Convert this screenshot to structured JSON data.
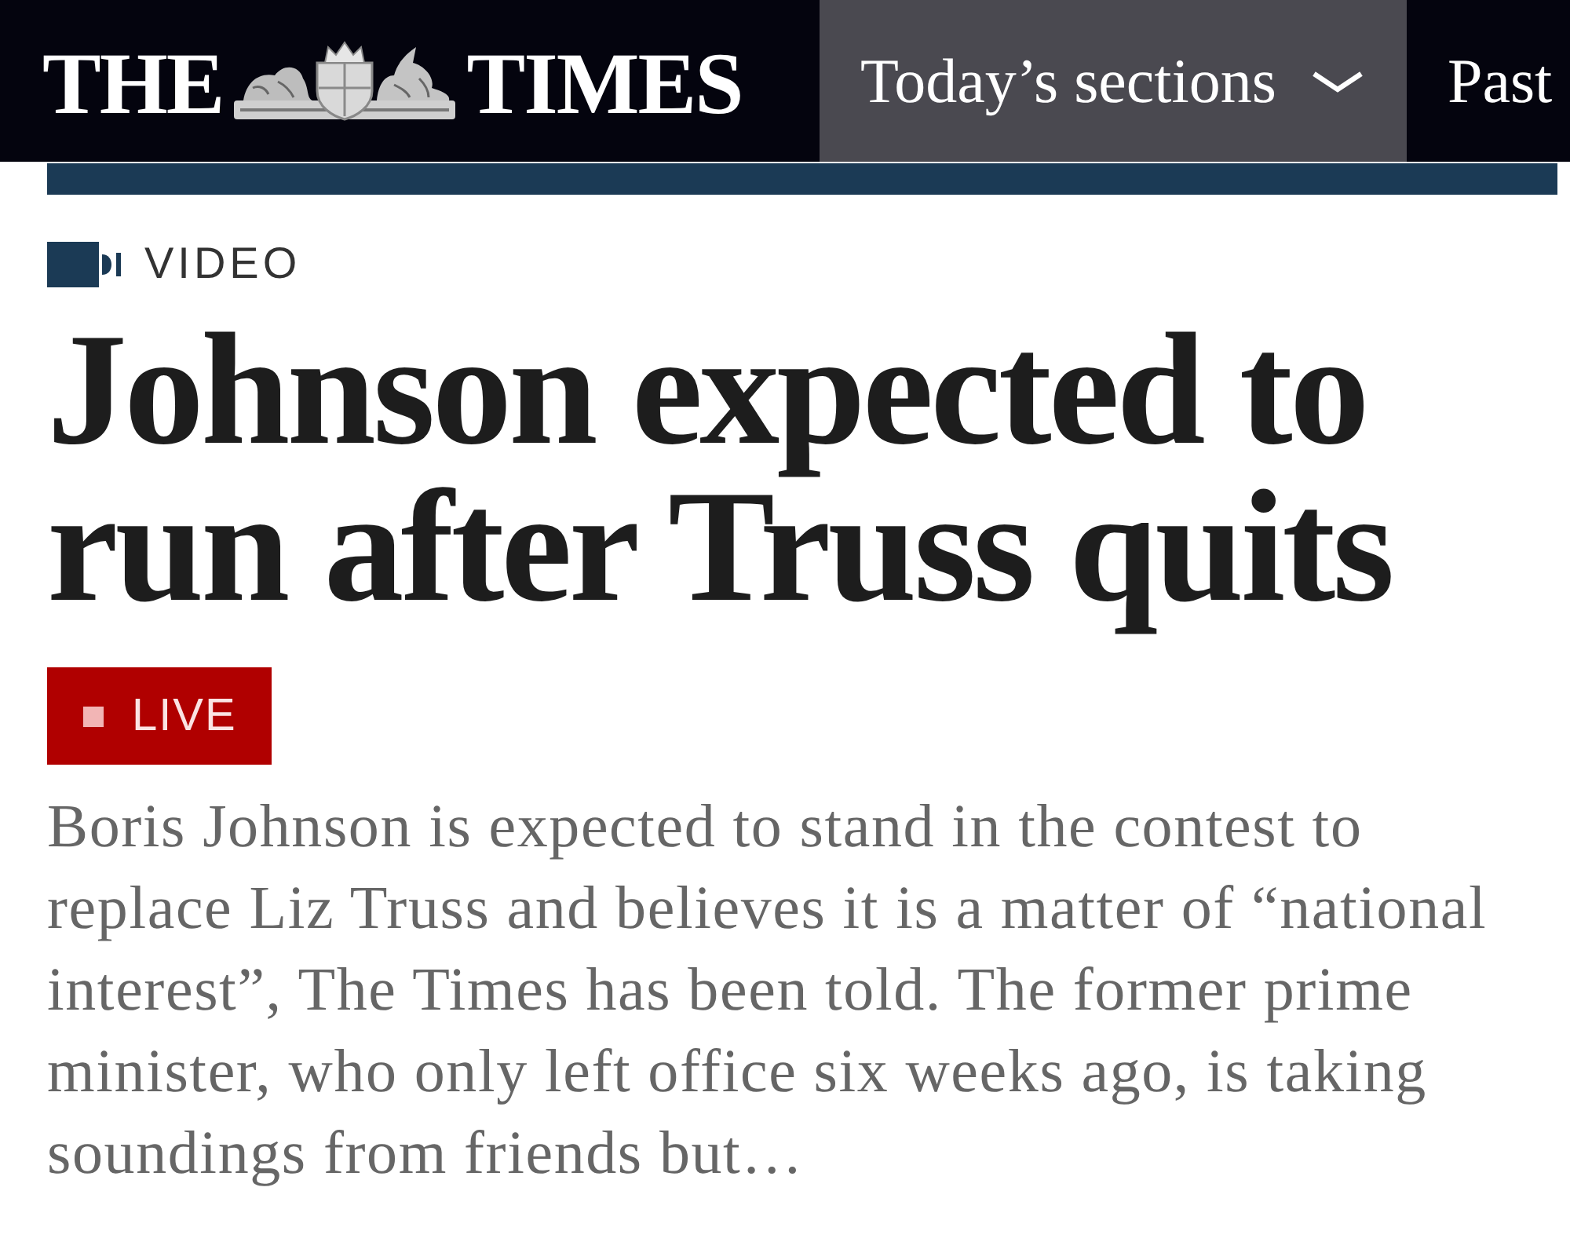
{
  "header": {
    "logo": {
      "words": [
        "THE",
        "TIMES"
      ]
    },
    "nav": [
      {
        "label": "Today’s sections",
        "kind": "dropdown",
        "selected": true
      },
      {
        "label": "Past",
        "kind": "link",
        "selected": false
      }
    ]
  },
  "article": {
    "category": "VIDEO",
    "headline": "Johnson expected to run after Truss quits",
    "badge": "LIVE",
    "summary": "Boris Johnson is expected to stand in the contest to replace Liz Truss and believes it is a matter of “national interest”, The Times has been told. The former prime minister, who only left office six weeks ago, is taking soundings from friends but…"
  }
}
